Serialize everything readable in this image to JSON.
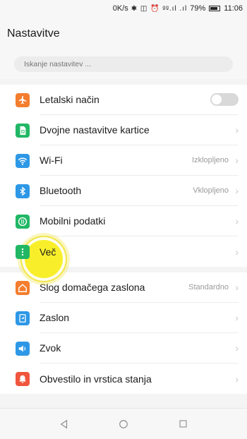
{
  "status_bar": {
    "speed": "0K/s",
    "signal_glyphs": "✱ ◫ ⏰ ᵍᵍ.ıl .ıl",
    "battery_percent": "79%",
    "time": "11:06"
  },
  "header": {
    "title": "Nastavitve"
  },
  "search": {
    "placeholder": "Iskanje nastavitev ..."
  },
  "groups": [
    {
      "items": [
        {
          "label": "Letalski način",
          "icon": "airplane-icon",
          "color": "#f47d2e",
          "control": "toggle"
        },
        {
          "label": "Dvojne nastavitve kartice",
          "icon": "sim-card-icon",
          "color": "#21b765",
          "control": "chevron"
        },
        {
          "label": "Wi-Fi",
          "icon": "wifi-icon",
          "color": "#2e98e6",
          "value": "Izklopljeno",
          "control": "chevron"
        },
        {
          "label": "Bluetooth",
          "icon": "bluetooth-icon",
          "color": "#2e98e6",
          "value": "Vklopljeno",
          "control": "chevron"
        },
        {
          "label": "Mobilni podatki",
          "icon": "mobile-data-icon",
          "color": "#21b765",
          "control": "chevron"
        },
        {
          "label": "Več",
          "icon": "more-icon",
          "color": "#21b765",
          "control": "chevron"
        }
      ]
    },
    {
      "items": [
        {
          "label": "Slog domačega zaslona",
          "icon": "home-icon",
          "color": "#f47d2e",
          "value": "Standardno",
          "control": "chevron"
        },
        {
          "label": "Zaslon",
          "icon": "display-icon",
          "color": "#2e98e6",
          "control": "chevron"
        },
        {
          "label": "Zvok",
          "icon": "speaker-icon",
          "color": "#2e98e6",
          "control": "chevron"
        },
        {
          "label": "Obvestilo in vrstica stanja",
          "icon": "notification-icon",
          "color": "#f0553e",
          "control": "chevron"
        }
      ]
    }
  ]
}
